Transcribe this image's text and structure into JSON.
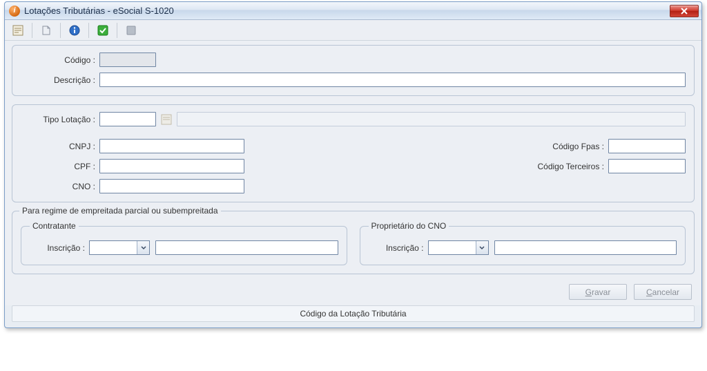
{
  "window": {
    "title": "Lotações Tributárias - eSocial S-1020"
  },
  "toolbar": {
    "icons": [
      "form-icon",
      "document-icon",
      "info-icon",
      "confirm-icon",
      "record-icon"
    ]
  },
  "fields": {
    "codigo_label": "Código :",
    "codigo_value": "",
    "descricao_label": "Descrição :",
    "descricao_value": "",
    "tipo_lotacao_label": "Tipo Lotação :",
    "tipo_lotacao_value": "",
    "tipo_lotacao_desc": "",
    "cnpj_label": "CNPJ :",
    "cnpj_value": "",
    "cpf_label": "CPF :",
    "cpf_value": "",
    "cno_label": "CNO :",
    "cno_value": "",
    "codigo_fpas_label": "Código Fpas :",
    "codigo_fpas_value": "",
    "codigo_terceiros_label": "Código Terceiros :",
    "codigo_terceiros_value": ""
  },
  "regime": {
    "group_title": "Para regime de empreitada parcial ou subempreitada",
    "contratante": {
      "title": "Contratante",
      "inscricao_label": "Inscrição :",
      "tipo_value": "",
      "numero_value": ""
    },
    "proprietario": {
      "title": "Proprietário do CNO",
      "inscricao_label": "Inscrição :",
      "tipo_value": "",
      "numero_value": ""
    }
  },
  "buttons": {
    "gravar_prefix": "G",
    "gravar_rest": "ravar",
    "cancelar_prefix": "C",
    "cancelar_rest": "ancelar"
  },
  "statusbar": {
    "text": "Código da Lotação Tributária"
  }
}
